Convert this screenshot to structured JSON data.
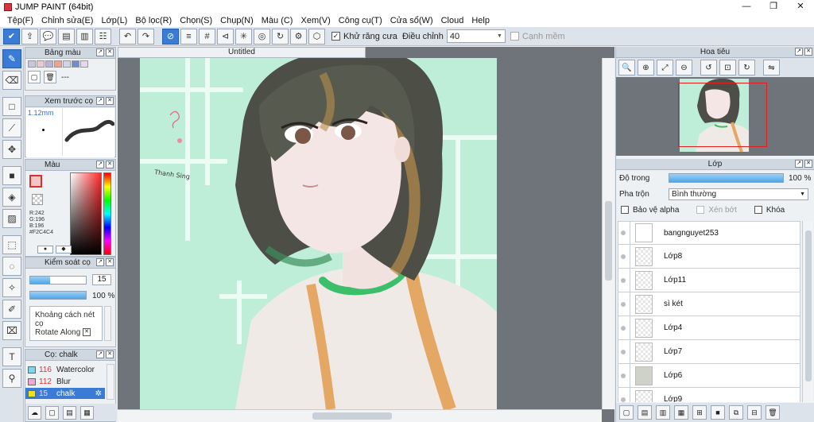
{
  "window": {
    "title": "JUMP PAINT (64bit)",
    "controls": [
      "—",
      "❐",
      "✕"
    ]
  },
  "menu": [
    "Tệp(F)",
    "Chỉnh sửa(E)",
    "Lớp(L)",
    "Bộ lọc(R)",
    "Chọn(S)",
    "Chụp(N)",
    "Màu (C)",
    "Xem(V)",
    "Công cụ(T)",
    "Cửa sổ(W)",
    "Cloud",
    "Help"
  ],
  "toolbar": {
    "antialias_label": "Khử răng cưa",
    "adjust_label": "Điều chỉnh",
    "adjust_value": "40",
    "snap_label": "Cạnh mềm"
  },
  "panels": {
    "palette_title": "Bảng màu",
    "palette_more": "---",
    "palette_swatches": [
      "#c9c4e0",
      "#ecc7d4",
      "#b9b1d8",
      "#f4a08e",
      "#d0d6ea",
      "#6a8ecf",
      "#e8d5f0"
    ],
    "brush_preview_title": "Xem trước cọ",
    "brush_size": "1.12mm",
    "color_title": "Màu",
    "color_readout": [
      "R:242",
      "G:196",
      "B:196",
      "#F2C4C4"
    ],
    "color_main_hex": "#F2C4C4",
    "brush_control_title": "Kiểm soát cọ",
    "brush_size_value": "15",
    "brush_opacity_value": "100 %",
    "brush_size_fraction": 0.35,
    "brush_list": [
      "Khoảng cách nét cọ",
      "Rotate Along"
    ],
    "brush_set_title": "Cọ: chalk",
    "brushes": [
      {
        "num": "116",
        "name": "Watercolor",
        "color": "#7fd6ea"
      },
      {
        "num": "112",
        "name": "Blur",
        "color": "#f4a6d4"
      },
      {
        "num": "15",
        "name": "chalk",
        "color": "#f0e21a"
      }
    ]
  },
  "canvas": {
    "doc_title": "Untitled",
    "signature": "Thanh Sing"
  },
  "navigator": {
    "title": "Hoa tiêu"
  },
  "layers": {
    "title": "Lớp",
    "opacity_label": "Độ trong",
    "opacity_value": "100 %",
    "blend_label": "Pha trộn",
    "blend_value": "Bình thường",
    "protect_alpha": "Bảo vệ alpha",
    "clipping": "Xén bớt",
    "lock": "Khóa",
    "items": [
      "bangnguyet253",
      "Lớp8",
      "Lớp11",
      "sì két",
      "Lớp4",
      "Lớp7",
      "Lớp6",
      "Lớp9"
    ]
  }
}
